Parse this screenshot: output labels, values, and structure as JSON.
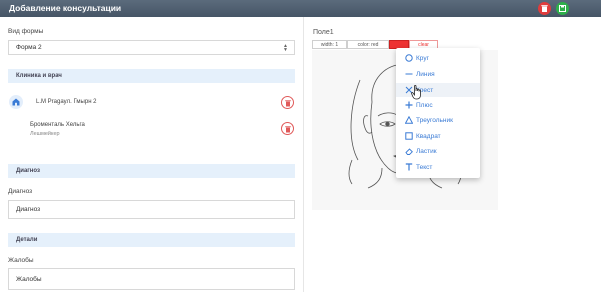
{
  "window": {
    "title": "Добавление консультации",
    "delete_icon": "trash-icon",
    "save_icon": "save-icon",
    "colors": {
      "titlebar": "#52616f",
      "delete": "#e03c3c",
      "save": "#2eaf4a",
      "accent": "#3a7bd5"
    }
  },
  "form": {
    "form_type_label": "Вид формы",
    "form_type_value": "Форма 2",
    "clinic_section": "Клиника и врач",
    "clinic_name": "L.M Pragayл. Гмырн 2",
    "doctor_name": "Броменталь Хельга",
    "doctor_role": "Лешмейкер",
    "diagnosis_section": "Диагноз",
    "diagnosis_label": "Диагноз",
    "diagnosis_value": "Диагноз",
    "details_section": "Детали",
    "complaints_label": "Жалобы",
    "complaints_value": "Жалобы"
  },
  "drawing": {
    "field_title": "Поле1",
    "width_label": "width: 1",
    "color_label": "color: red",
    "clear_label": "clear",
    "menu": [
      {
        "label": "Круг",
        "icon": "circle-icon"
      },
      {
        "label": "Линия",
        "icon": "line-icon"
      },
      {
        "label": "Крест",
        "icon": "cross-icon"
      },
      {
        "label": "Плюс",
        "icon": "plus-icon"
      },
      {
        "label": "Треугольник",
        "icon": "triangle-icon"
      },
      {
        "label": "Квадрат",
        "icon": "square-icon"
      },
      {
        "label": "Ластик",
        "icon": "eraser-icon"
      },
      {
        "label": "Текст",
        "icon": "text-icon"
      }
    ]
  }
}
